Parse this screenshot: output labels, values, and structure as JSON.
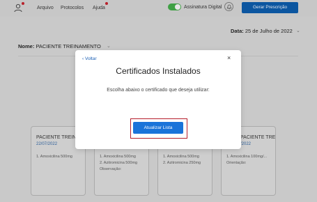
{
  "topbar": {
    "menu": [
      "Arquivo",
      "Protocolos",
      "Ajuda"
    ],
    "digital_signature_label": "Assinatura Digital",
    "digital_signature_enabled": true,
    "generate_button": "Gerar Prescrição",
    "icons": [
      "user-icon",
      "bell-icon"
    ],
    "accent_color": "#0c56a0",
    "toggle_color": "#3fa044"
  },
  "page": {
    "date_label": "Data:",
    "date_value": "25 de Julho de 2022",
    "name_label": "Nome:",
    "name_value": "PACIENTE TREINAMENTO"
  },
  "cards": [
    {
      "title": "PACIENTE TREIN",
      "date": "22/07/2022",
      "lines": [
        "1. Amoxicilina 500mg"
      ]
    },
    {
      "title": "",
      "date": "",
      "lines": [
        "1. Amoxicilina 500mg",
        "2. Azitromicina 500mg",
        "Observação:"
      ]
    },
    {
      "title": "",
      "date": "",
      "lines": [
        "1. Amoxicilina 500mg",
        "2. Azitromicina 250mg"
      ]
    },
    {
      "title": "PACIENTE TREIN...",
      "date": "/2022",
      "lines": [
        "1. Amoxicilina 100mg/...",
        "Orientação:"
      ]
    }
  ],
  "modal": {
    "back_label": "Voltar",
    "close_label": "×",
    "title": "Certificados Instalados",
    "subtitle": "Escolha abaixo o certificado que deseja utilizar:",
    "refresh_button": "Atualizar Lista",
    "button_color": "#1a73d9",
    "highlight_color": "#b51e2b"
  }
}
